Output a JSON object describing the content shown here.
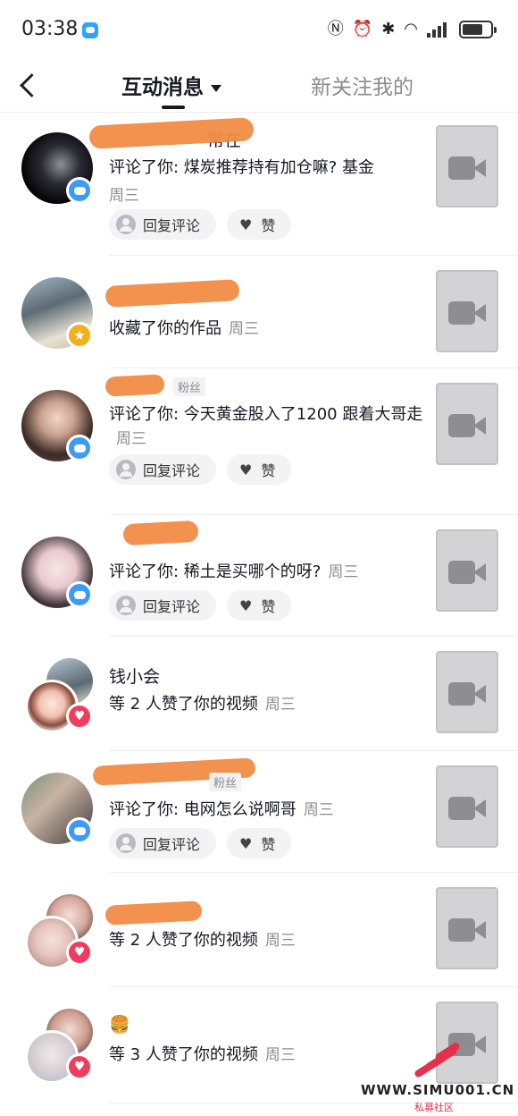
{
  "status_bar": {
    "time": "03:38"
  },
  "header": {
    "tabs": [
      {
        "label": "互动消息",
        "active": true
      },
      {
        "label": "新关注我的",
        "active": false
      }
    ]
  },
  "notifications": [
    {
      "name_visible": "常在",
      "message": "评论了你: 煤炭推荐持有加仓嘛? 基金",
      "time": "周三",
      "badge": "comment-icon"
    },
    {
      "message": "收藏了你的作品",
      "time": "周三",
      "badge": "star-icon"
    },
    {
      "fan_tag": "粉丝",
      "message": "评论了你: 今天黄金股入了1200  跟着大哥走",
      "time": "周三",
      "badge": "comment-icon"
    },
    {
      "message": "评论了你: 稀土是买哪个的呀?",
      "time": "周三",
      "badge": "comment-icon"
    },
    {
      "name": "钱小会",
      "message": "等 2 人赞了你的视频",
      "time": "周三",
      "badge": "heart-icon"
    },
    {
      "fan_tag": "粉丝",
      "message": "评论了你: 电网怎么说啊哥",
      "time": "周三",
      "badge": "comment-icon"
    },
    {
      "message": "等 2 人赞了你的视频",
      "time": "周三",
      "badge": "heart-icon"
    },
    {
      "name": "🍔",
      "message": "等 3 人赞了你的视频",
      "time": "周三",
      "badge": "heart-icon"
    }
  ],
  "actions": {
    "reply_label": "回复评论",
    "like_label": "赞"
  },
  "watermark": {
    "site": "WWW.SIMU001.CN",
    "sub": "私募社区"
  },
  "colors": {
    "comment_badge": "#3b9cf7",
    "star_badge": "#f3b01d",
    "like_badge": "#f23c5d",
    "redaction": "#f28b45"
  }
}
